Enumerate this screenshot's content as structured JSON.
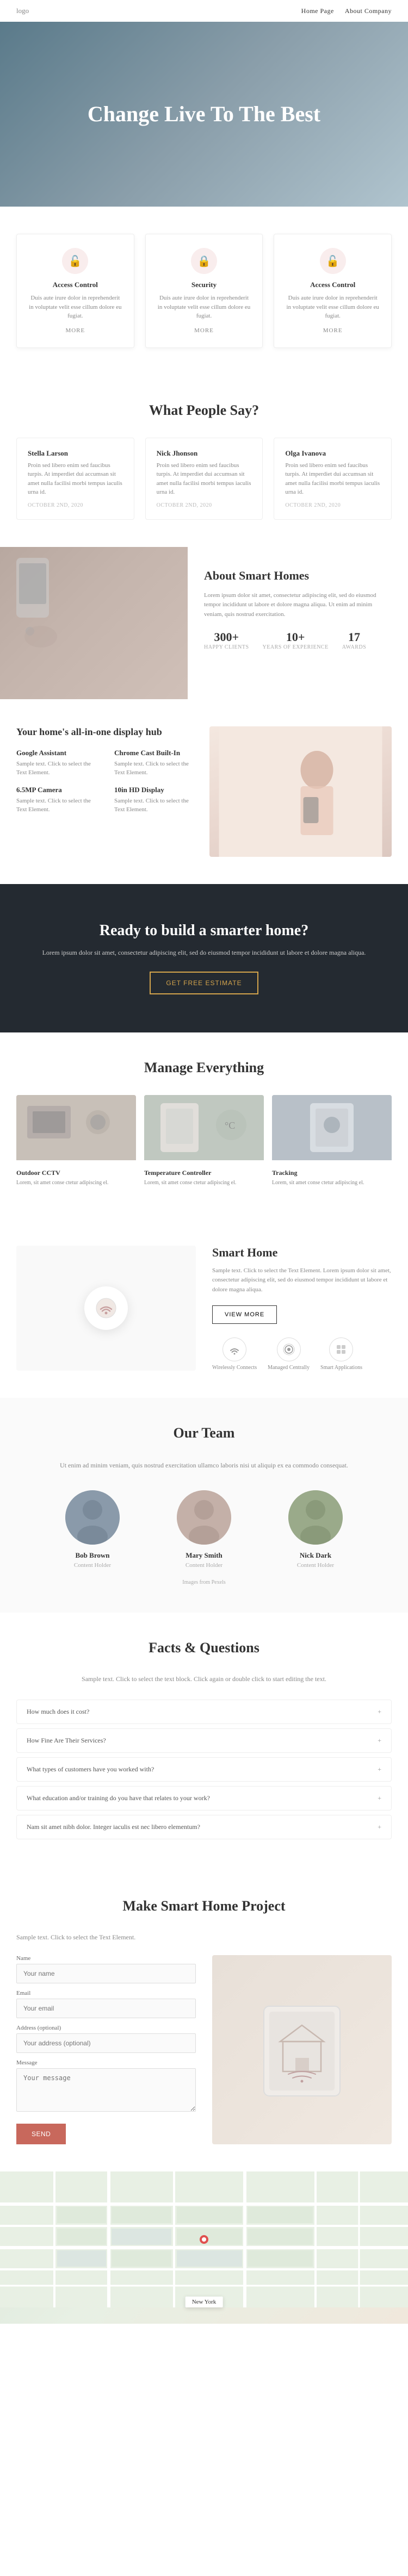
{
  "nav": {
    "logo": "logo",
    "links": [
      "Home Page",
      "About Company"
    ]
  },
  "hero": {
    "title": "Change Live To The Best"
  },
  "features": {
    "cards": [
      {
        "icon": "🔓",
        "title": "Access Control",
        "text": "Duis aute irure dolor in reprehenderit in voluptate velit esse cillum dolore eu fugiat.",
        "more": "MORE"
      },
      {
        "icon": "🔒",
        "title": "Security",
        "text": "Duis aute irure dolor in reprehenderit in voluptate velit esse cillum dolore eu fugiat.",
        "more": "MORE"
      },
      {
        "icon": "🔓",
        "title": "Access Control",
        "text": "Duis aute irure dolor in reprehenderit in voluptate velit esse cillum dolore eu fugiat.",
        "more": "MORE"
      }
    ]
  },
  "testimonials": {
    "title": "What People Say?",
    "cards": [
      {
        "name": "Stella Larson",
        "text": "Proin sed libero enim sed faucibus turpis. At imperdiet dui accumsan sit amet nulla facilisi morbi tempus iaculis urna id.",
        "date": "OCTOBER 2ND, 2020"
      },
      {
        "name": "Nick Jhonson",
        "text": "Proin sed libero enim sed faucibus turpis. At imperdiet dui accumsan sit amet nulla facilisi morbi tempus iaculis urna id.",
        "date": "OCTOBER 2ND, 2020"
      },
      {
        "name": "Olga Ivanova",
        "text": "Proin sed libero enim sed faucibus turpis. At imperdiet dui accumsan sit amet nulla facilisi morbi tempus iaculis urna id.",
        "date": "OCTOBER 2ND, 2020"
      }
    ]
  },
  "about": {
    "title": "About Smart Homes",
    "text": "Lorem ipsum dolor sit amet, consectetur adipiscing elit, sed do eiusmod tempor incididunt ut labore et dolore magna aliqua. Ut enim ad minim veniam, quis nostrud exercitation.",
    "stats": [
      {
        "number": "300+",
        "label": "HAPPY CLIENTS"
      },
      {
        "number": "10+",
        "label": "YEARS OF EXPERIENCE"
      },
      {
        "number": "17",
        "label": "AWARDS"
      }
    ]
  },
  "hub": {
    "intro": "Your home's all-in-one display hub",
    "items": [
      {
        "label": "Google Assistant",
        "text": "Sample text. Click to select the Text Element."
      },
      {
        "label": "Chrome Cast Built-In",
        "text": "Sample text. Click to select the Text Element."
      },
      {
        "label": "6.5MP Camera",
        "text": "Sample text. Click to select the Text Element."
      },
      {
        "label": "10in HD Display",
        "text": "Sample text. Click to select the Text Element."
      }
    ]
  },
  "cta": {
    "title": "Ready to build a smarter home?",
    "text": "Lorem ipsum dolor sit amet, consectetur adipiscing elit, sed do eiusmod tempor incididunt ut labore et dolore magna aliqua.",
    "button": "GET FREE ESTIMATE"
  },
  "manage": {
    "title": "Manage Everything",
    "cards": [
      {
        "title": "Outdoor CCTV",
        "text": "Lorem, sit amet conse ctetur adipiscing el."
      },
      {
        "title": "Temperature Controller",
        "text": "Lorem, sit amet conse ctetur adipiscing el."
      },
      {
        "title": "Tracking",
        "text": "Lorem, sit amet conse ctetur adipiscing el."
      }
    ]
  },
  "smart": {
    "title": "Smart Home",
    "text": "Sample text. Click to select the Text Element. Lorem ipsum dolor sit amet, consectetur adipiscing elit, sed do eiusmod tempor incididunt ut labore et dolore magna aliqua.",
    "button": "VIEW MORE",
    "icons": [
      {
        "label": "Wirelessly Connects"
      },
      {
        "label": "Managed Centrally"
      },
      {
        "label": "Smart Applications"
      }
    ]
  },
  "team": {
    "title": "Our Team",
    "subtitle": "Ut enim ad minim veniam, quis nostrud exercitation ullamco laboris nisi ut aliquip ex ea commodo consequat.",
    "members": [
      {
        "name": "Bob Brown",
        "role": "Content Holder"
      },
      {
        "name": "Mary Smith",
        "role": "Content Holder"
      },
      {
        "name": "Nick Dark",
        "role": "Content Holder"
      }
    ],
    "credit": "Images from Pexels"
  },
  "faq": {
    "title": "Facts & Questions",
    "subtitle": "Sample text. Click to select the text block. Click again or double click to start editing the text.",
    "questions": [
      "How much does it cost?",
      "How Fine Are Their Services?",
      "What types of customers have you worked with?",
      "What education and/or training do you have that relates to your work?",
      "Nam sit amet nibh dolor. Integer iaculis est nec libero elementum?"
    ]
  },
  "contact": {
    "title": "Make Smart Home Project",
    "subtitle": "Sample text. Click to select the Text Element.",
    "fields": {
      "name_label": "Name",
      "name_placeholder": "Your name",
      "email_label": "Email",
      "email_placeholder": "Your email",
      "address_label": "Address (optional)",
      "address_placeholder": "Your address (optional)",
      "message_label": "Message",
      "message_placeholder": "Your message"
    },
    "submit": "SEND"
  },
  "map": {
    "label": "New York"
  }
}
